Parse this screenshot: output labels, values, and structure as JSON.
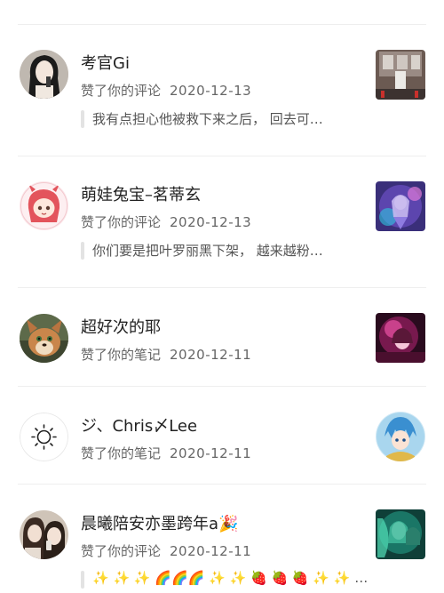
{
  "notifications": [
    {
      "name": "考官Gi",
      "action": "赞了你的评论",
      "date": "2020-12-13",
      "quote": "我有点担心他被救下来之后， 回去可…",
      "avatar_icon": "woman-portrait-avatar",
      "thumb_icon": "building-scene-thumbnail"
    },
    {
      "name": "萌娃兔宝–茗蒂玄",
      "action": "赞了你的评论",
      "date": "2020-12-13",
      "quote": "你们要是把叶罗丽黑下架， 越来越粉…",
      "avatar_icon": "anime-girl-avatar",
      "thumb_icon": "anime-character-thumbnail"
    },
    {
      "name": "超好次的耶",
      "action": "赞了你的笔记",
      "date": "2020-12-11",
      "avatar_icon": "fox-cartoon-avatar",
      "thumb_icon": "glowing-character-thumbnail"
    },
    {
      "name": "ジ、Chris〆Lee",
      "action": "赞了你的笔记",
      "date": "2020-12-11",
      "avatar_icon": "sun-icon-avatar",
      "thumb_icon": "anime-boy-thumbnail"
    },
    {
      "name": "晨曦陪安亦墨跨年a🎉",
      "action": "赞了你的评论",
      "date": "2020-12-11",
      "quote": "✨ ✨ ✨ 🌈🌈🌈 ✨ ✨ 🍓 🍓 🍓 ✨ ✨ …",
      "avatar_icon": "two-girls-avatar",
      "thumb_icon": "green-fairy-thumbnail"
    }
  ],
  "colors": {
    "divider": "#eeeeee",
    "name": "#222222",
    "meta": "#666666",
    "quote_bar": "#e3e3e3"
  }
}
